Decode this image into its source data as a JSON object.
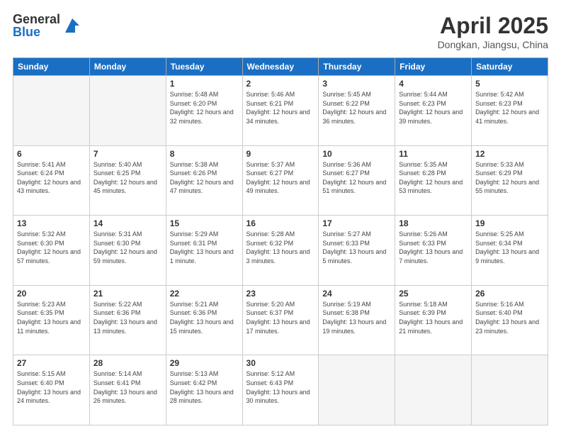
{
  "header": {
    "logo_general": "General",
    "logo_blue": "Blue",
    "title": "April 2025",
    "location": "Dongkan, Jiangsu, China"
  },
  "days_of_week": [
    "Sunday",
    "Monday",
    "Tuesday",
    "Wednesday",
    "Thursday",
    "Friday",
    "Saturday"
  ],
  "weeks": [
    [
      {
        "num": "",
        "info": ""
      },
      {
        "num": "",
        "info": ""
      },
      {
        "num": "1",
        "info": "Sunrise: 5:48 AM\nSunset: 6:20 PM\nDaylight: 12 hours and 32 minutes."
      },
      {
        "num": "2",
        "info": "Sunrise: 5:46 AM\nSunset: 6:21 PM\nDaylight: 12 hours and 34 minutes."
      },
      {
        "num": "3",
        "info": "Sunrise: 5:45 AM\nSunset: 6:22 PM\nDaylight: 12 hours and 36 minutes."
      },
      {
        "num": "4",
        "info": "Sunrise: 5:44 AM\nSunset: 6:23 PM\nDaylight: 12 hours and 39 minutes."
      },
      {
        "num": "5",
        "info": "Sunrise: 5:42 AM\nSunset: 6:23 PM\nDaylight: 12 hours and 41 minutes."
      }
    ],
    [
      {
        "num": "6",
        "info": "Sunrise: 5:41 AM\nSunset: 6:24 PM\nDaylight: 12 hours and 43 minutes."
      },
      {
        "num": "7",
        "info": "Sunrise: 5:40 AM\nSunset: 6:25 PM\nDaylight: 12 hours and 45 minutes."
      },
      {
        "num": "8",
        "info": "Sunrise: 5:38 AM\nSunset: 6:26 PM\nDaylight: 12 hours and 47 minutes."
      },
      {
        "num": "9",
        "info": "Sunrise: 5:37 AM\nSunset: 6:27 PM\nDaylight: 12 hours and 49 minutes."
      },
      {
        "num": "10",
        "info": "Sunrise: 5:36 AM\nSunset: 6:27 PM\nDaylight: 12 hours and 51 minutes."
      },
      {
        "num": "11",
        "info": "Sunrise: 5:35 AM\nSunset: 6:28 PM\nDaylight: 12 hours and 53 minutes."
      },
      {
        "num": "12",
        "info": "Sunrise: 5:33 AM\nSunset: 6:29 PM\nDaylight: 12 hours and 55 minutes."
      }
    ],
    [
      {
        "num": "13",
        "info": "Sunrise: 5:32 AM\nSunset: 6:30 PM\nDaylight: 12 hours and 57 minutes."
      },
      {
        "num": "14",
        "info": "Sunrise: 5:31 AM\nSunset: 6:30 PM\nDaylight: 12 hours and 59 minutes."
      },
      {
        "num": "15",
        "info": "Sunrise: 5:29 AM\nSunset: 6:31 PM\nDaylight: 13 hours and 1 minute."
      },
      {
        "num": "16",
        "info": "Sunrise: 5:28 AM\nSunset: 6:32 PM\nDaylight: 13 hours and 3 minutes."
      },
      {
        "num": "17",
        "info": "Sunrise: 5:27 AM\nSunset: 6:33 PM\nDaylight: 13 hours and 5 minutes."
      },
      {
        "num": "18",
        "info": "Sunrise: 5:26 AM\nSunset: 6:33 PM\nDaylight: 13 hours and 7 minutes."
      },
      {
        "num": "19",
        "info": "Sunrise: 5:25 AM\nSunset: 6:34 PM\nDaylight: 13 hours and 9 minutes."
      }
    ],
    [
      {
        "num": "20",
        "info": "Sunrise: 5:23 AM\nSunset: 6:35 PM\nDaylight: 13 hours and 11 minutes."
      },
      {
        "num": "21",
        "info": "Sunrise: 5:22 AM\nSunset: 6:36 PM\nDaylight: 13 hours and 13 minutes."
      },
      {
        "num": "22",
        "info": "Sunrise: 5:21 AM\nSunset: 6:36 PM\nDaylight: 13 hours and 15 minutes."
      },
      {
        "num": "23",
        "info": "Sunrise: 5:20 AM\nSunset: 6:37 PM\nDaylight: 13 hours and 17 minutes."
      },
      {
        "num": "24",
        "info": "Sunrise: 5:19 AM\nSunset: 6:38 PM\nDaylight: 13 hours and 19 minutes."
      },
      {
        "num": "25",
        "info": "Sunrise: 5:18 AM\nSunset: 6:39 PM\nDaylight: 13 hours and 21 minutes."
      },
      {
        "num": "26",
        "info": "Sunrise: 5:16 AM\nSunset: 6:40 PM\nDaylight: 13 hours and 23 minutes."
      }
    ],
    [
      {
        "num": "27",
        "info": "Sunrise: 5:15 AM\nSunset: 6:40 PM\nDaylight: 13 hours and 24 minutes."
      },
      {
        "num": "28",
        "info": "Sunrise: 5:14 AM\nSunset: 6:41 PM\nDaylight: 13 hours and 26 minutes."
      },
      {
        "num": "29",
        "info": "Sunrise: 5:13 AM\nSunset: 6:42 PM\nDaylight: 13 hours and 28 minutes."
      },
      {
        "num": "30",
        "info": "Sunrise: 5:12 AM\nSunset: 6:43 PM\nDaylight: 13 hours and 30 minutes."
      },
      {
        "num": "",
        "info": ""
      },
      {
        "num": "",
        "info": ""
      },
      {
        "num": "",
        "info": ""
      }
    ]
  ]
}
